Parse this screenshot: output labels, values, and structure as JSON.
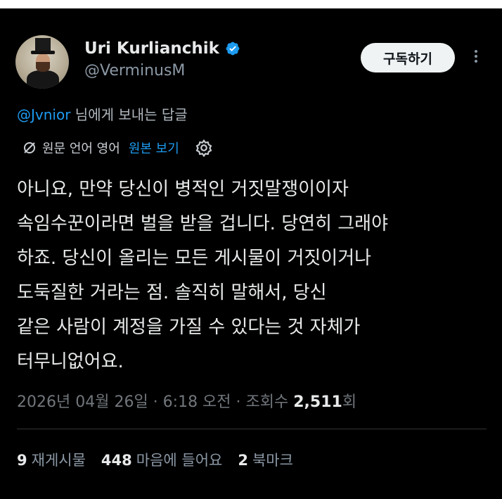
{
  "user": {
    "display_name": "Uri Kurlianchik",
    "handle": "@VerminusM",
    "verified": true
  },
  "actions": {
    "subscribe_label": "구독하기"
  },
  "reply": {
    "mention": "@Jvnior",
    "suffix": " 님에게 보내는 답글"
  },
  "translation": {
    "label": "원문 언어 영어",
    "show_original": "원본 보기"
  },
  "tweet": {
    "lines": [
      "아니요, 만약 당신이 병적인 거짓말쟁이이자",
      "속임수꾼이라면 벌을 받을 겁니다. 당연히 그래야",
      "하죠. 당신이 올리는 모든 게시물이 거짓이거나",
      "도둑질한 거라는 점. 솔직히 말해서, 당신",
      "같은 사람이 계정을 가질 수 있다는 것 자체가",
      "터무니없어요."
    ]
  },
  "meta": {
    "timestamp": "2026년 04월 26일 · 6:18 오전 · 조회수 ",
    "views": "2,511",
    "views_suffix": "회"
  },
  "stats": {
    "reposts": "9",
    "reposts_label": "재게시물",
    "likes": "448",
    "likes_label": "마음에 들어요",
    "bookmarks": "2",
    "bookmarks_label": "북마크"
  },
  "colors": {
    "background": "#000000",
    "accent": "#1d9bf0",
    "text": "#e7e9ea",
    "muted": "#71767b"
  }
}
